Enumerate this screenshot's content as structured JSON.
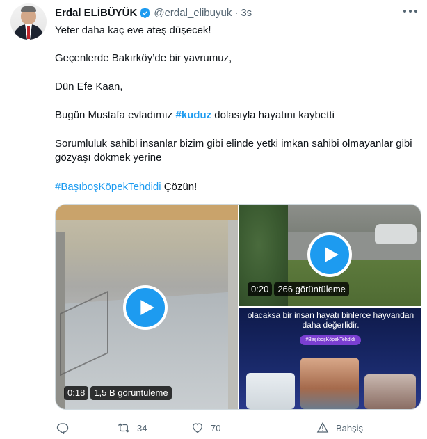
{
  "author": {
    "name": "Erdal ELİBÜYÜK",
    "handle": "@erdal_elibuyuk",
    "separator": "·",
    "time": "3s"
  },
  "tweet": {
    "line1": "Yeter daha kaç eve ateş düşecek!",
    "line2": "Geçenlerde Bakırköy’de bir yavrumuz,",
    "line3": "Dün Efe Kaan,",
    "line4_pre": "Bugün Mustafa evladımız ",
    "line4_tag": "#kuduz",
    "line4_post": " dolasıyla hayatını kaybetti",
    "line5": "Sorumluluk sahibi insanlar bizim gibi elinde yetki imkan sahibi olmayanlar gibi gözyaşı dökmek yerine",
    "line6_tag": "#BaşıboşKöpekTehdidi",
    "line6_post": " Çözün!"
  },
  "media": {
    "video1": {
      "duration": "0:18",
      "views": "1,5 B görüntüleme"
    },
    "video2": {
      "duration": "0:20",
      "views": "266 görüntüleme"
    },
    "image3": {
      "caption": "olacaksa bir insan hayatı binlerce hayvandan daha değerlidir.",
      "tag": "#BaşıboşKöpekTehdidi"
    }
  },
  "actions": {
    "replies": "",
    "retweets": "34",
    "likes": "70",
    "tip": "Bahşiş"
  },
  "colors": {
    "accent": "#1d9bf0",
    "text": "#0f1419",
    "muted": "#536471"
  },
  "icons": [
    "verified-badge-icon",
    "more-icon",
    "play-icon",
    "reply-icon",
    "retweet-icon",
    "like-icon",
    "tip-icon"
  ]
}
